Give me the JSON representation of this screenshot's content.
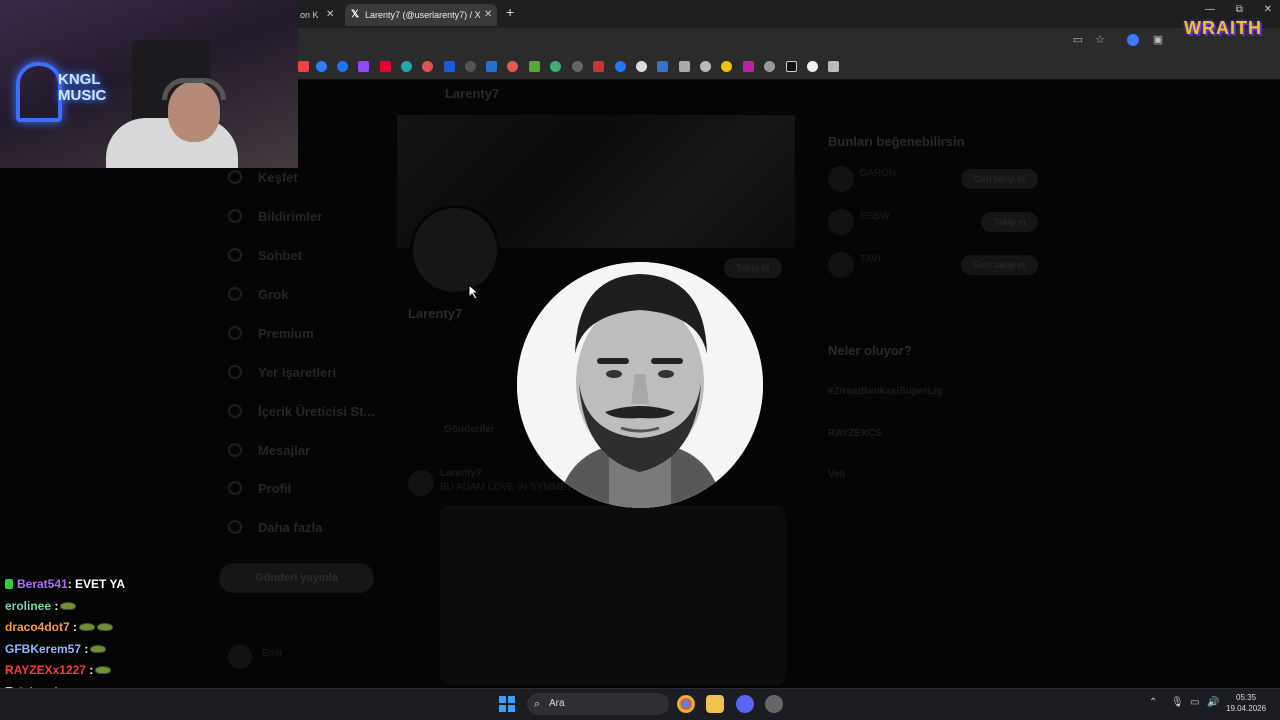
{
  "browser": {
    "tabs": [
      {
        "label": "on K",
        "active": false
      },
      {
        "label": "Larenty7 (@userlarenty7) / X",
        "active": true
      }
    ],
    "new_tab": "+",
    "window_controls": [
      "—",
      "⧉",
      "✕"
    ]
  },
  "webpage": {
    "profile_header_name": "Larenty7",
    "nav": [
      "Keşfet",
      "Bildirimler",
      "Sohbet",
      "Grok",
      "Premium",
      "Yer işaretleri",
      "İçerik Üreticisi St...",
      "Mesajlar",
      "Profil",
      "Daha fazla"
    ],
    "post_button": "Gönderi yayınla",
    "profile_name": "Larenty7",
    "edit_button": "Takip et",
    "tab_posts": "Gönderiler",
    "tweet_author": "Larenty7",
    "tweet_text": "BU ADAM LOVE İN SYMMETRY",
    "suggestions_title": "Bunları beğenebilirsin",
    "suggestions": [
      {
        "name": "DARON",
        "button": "Geri takip et"
      },
      {
        "name": "ESBW",
        "button": "Takip et"
      },
      {
        "name": "TAVI",
        "button": "Geri takip et"
      }
    ],
    "trends_title": "Neler oluyor?",
    "trends": [
      "#ZiraatBankasiSuperLig",
      "RAYZEXCS",
      "Veli"
    ],
    "account_name": "Emir"
  },
  "stream_overlay": {
    "neon_sign": "KNGL\nMUSIC",
    "wraith_logo": "WRAITH"
  },
  "chat": [
    {
      "user": "Berat541",
      "color": "#b36bff",
      "message": ": EVET YA",
      "emotes": 0,
      "badge": "#2ecc40"
    },
    {
      "user": "erolinee",
      "color": "#7ad7a8",
      "message": " :",
      "emotes": 1,
      "badge": ""
    },
    {
      "user": "draco4dot7",
      "color": "#f0a040",
      "message": " :",
      "emotes": 2,
      "badge": ""
    },
    {
      "user": "GFBKerem57",
      "color": "#8fb7ff",
      "message": " :",
      "emotes": 1,
      "badge": ""
    },
    {
      "user": "RAYZEXx1227",
      "color": "#ff3b3b",
      "message": " :",
      "emotes": 1,
      "badge": ""
    },
    {
      "user": "Srimed",
      "color": "#4aa3ff",
      "message": " :",
      "emotes": 1,
      "badge": "#cccccc"
    },
    {
      "user": "tonnymontana31",
      "color": "#ffd23f",
      "message": " :",
      "emotes": 1,
      "badge": ""
    }
  ],
  "taskbar": {
    "search_placeholder": "Ara",
    "time": "05:35",
    "date": "19.04.2026"
  },
  "colors": {
    "page_bg": "#050505",
    "taskbar_bg": "#1b1d22",
    "wraith_gold": "#f1c40f"
  }
}
